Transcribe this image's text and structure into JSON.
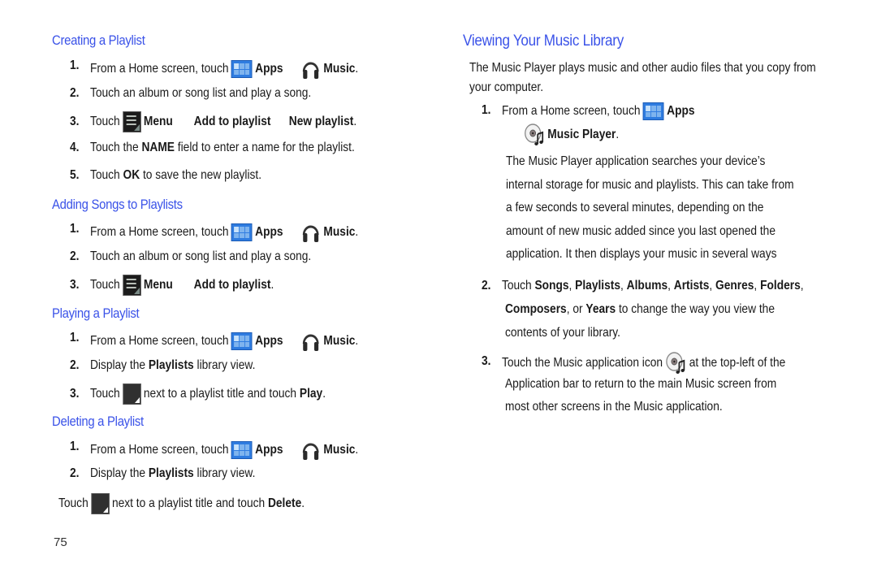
{
  "left": {
    "sections": [
      {
        "title": "Creating a Playlist",
        "steps": [
          {
            "num": "1.",
            "pre": "From a Home screen, touch",
            "apps": "Apps",
            "music": "Music",
            "end": "."
          },
          {
            "num": "2.",
            "text": "Touch an album or song list and play a song."
          },
          {
            "num": "3.",
            "pre": "Touch",
            "menu": "Menu",
            "b1": "Add to playlist",
            "b2": "New playlist",
            "end": "."
          },
          {
            "num": "4.",
            "pre": "Touch the",
            "bold": "NAME",
            "post": "field to enter a name for the playlist."
          },
          {
            "num": "5.",
            "pre": "Touch",
            "bold": "OK",
            "post": "to save the new playlist."
          }
        ]
      },
      {
        "title": "Adding Songs to Playlists",
        "steps": [
          {
            "num": "1.",
            "pre": "From a Home screen, touch",
            "apps": "Apps",
            "music": "Music",
            "end": "."
          },
          {
            "num": "2.",
            "text": "Touch an album or song list and play a song."
          },
          {
            "num": "3.",
            "pre": "Touch",
            "menu": "Menu",
            "b1": "Add to playlist",
            "end": "."
          }
        ]
      },
      {
        "title": "Playing a Playlist",
        "steps": [
          {
            "num": "1.",
            "pre": "From a Home screen, touch",
            "apps": "Apps",
            "music": "Music",
            "end": "."
          },
          {
            "num": "2.",
            "pre": "Display the",
            "bold": "Playlists",
            "post": "library view."
          },
          {
            "num": "3.",
            "pre": "Touch",
            "post": "next to a playlist title and touch",
            "bold": "Play",
            "end": "."
          }
        ]
      },
      {
        "title": "Deleting a Playlist",
        "steps": [
          {
            "num": "1.",
            "pre": "From a Home screen, touch",
            "apps": "Apps",
            "music": "Music",
            "end": "."
          },
          {
            "num": "2.",
            "pre": "Display the",
            "bold": "Playlists",
            "post": "library view."
          },
          {
            "num": "",
            "pre": "Touch",
            "post": "next to a playlist title and touch",
            "bold": "Delete",
            "end": "."
          }
        ]
      }
    ],
    "page_number": "75"
  },
  "right": {
    "title": "Viewing Your Music Library",
    "intro_1": "The Music Player plays music and other audio files that you copy from",
    "intro_2": "your computer.",
    "step1": {
      "num": "1.",
      "pre": "From a Home screen, touch",
      "apps": "Apps",
      "player": "Music Player",
      "end": "."
    },
    "step1_para": [
      "The Music Player application searches your device’s",
      "internal storage for music and playlists. This can take from",
      "a few seconds to several minutes, depending on the",
      "amount of new music added since you last opened the",
      "application. It then displays your music in several ways"
    ],
    "step2": {
      "num": "2.",
      "line1": [
        [
          "Touch ",
          false
        ],
        [
          "Songs",
          true
        ],
        [
          ", ",
          false
        ],
        [
          "Playlists",
          true
        ],
        [
          ", ",
          false
        ],
        [
          "Albums",
          true
        ],
        [
          ", ",
          false
        ],
        [
          "Artists",
          true
        ],
        [
          ", ",
          false
        ],
        [
          "Genres",
          true
        ],
        [
          ", ",
          false
        ],
        [
          "Folders",
          true
        ],
        [
          ",",
          false
        ]
      ],
      "line2": [
        [
          "Composers",
          true
        ],
        [
          ", or ",
          false
        ],
        [
          "Years",
          true
        ],
        [
          " to change the way you view the",
          false
        ]
      ],
      "line3": "contents of your library."
    },
    "step3": {
      "num": "3.",
      "pre": "Touch the Music application icon",
      "post": "at the top-left of the",
      "line2": "Application bar to return to the main Music screen from",
      "line3": "most other screens in the Music application."
    }
  },
  "colors": {
    "heading": "#3a52e8",
    "apps_icon": "#2f7ce0"
  }
}
